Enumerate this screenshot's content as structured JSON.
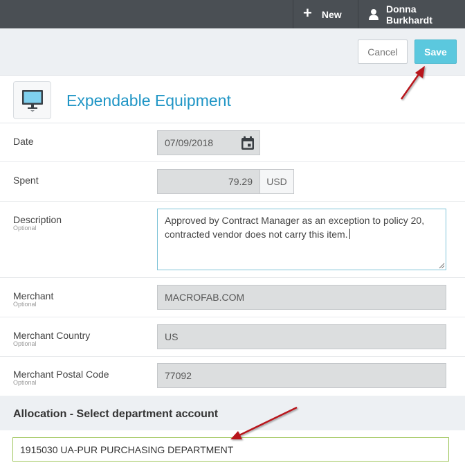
{
  "topbar": {
    "new_label": "New",
    "user_name": "Donna Burkhardt"
  },
  "actions": {
    "cancel_label": "Cancel",
    "save_label": "Save"
  },
  "page": {
    "title": "Expendable Equipment",
    "icon": "monitor-icon"
  },
  "form": {
    "date": {
      "label": "Date",
      "value": "07/09/2018"
    },
    "spent": {
      "label": "Spent",
      "value": "79.29",
      "currency": "USD"
    },
    "description": {
      "label": "Description",
      "optional": "Optional",
      "value": "Approved by Contract Manager as an exception to policy 20, contracted vendor does not carry this item."
    },
    "merchant": {
      "label": "Merchant",
      "optional": "Optional",
      "value": "MACROFAB.COM"
    },
    "merchant_country": {
      "label": "Merchant Country",
      "optional": "Optional",
      "value": "US"
    },
    "merchant_postal": {
      "label": "Merchant Postal Code",
      "optional": "Optional",
      "value": "77092"
    }
  },
  "allocation": {
    "title": "Allocation - Select department account",
    "value": "1915030 UA-PUR PURCHASING DEPARTMENT"
  },
  "colors": {
    "topbar": "#4a4f54",
    "accent": "#1f95c5",
    "save": "#5bc8de",
    "annotation_arrow": "#b8141b"
  }
}
